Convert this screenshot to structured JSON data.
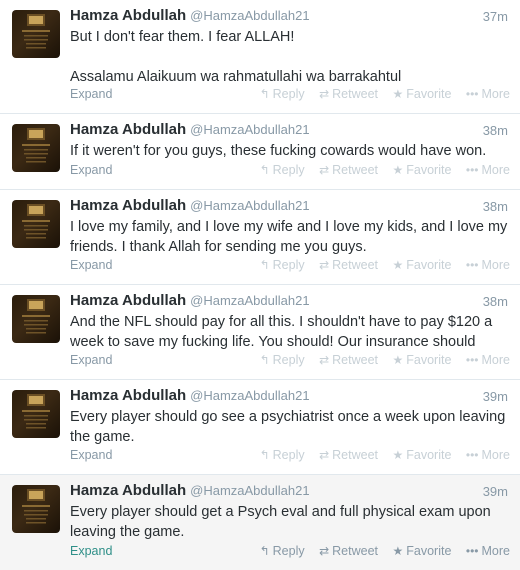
{
  "tweets": [
    {
      "fullname": "Hamza Abdullah",
      "username": "@HamzaAbdullah21",
      "time": "37m",
      "text": "But I don't fear them. I fear ALLAH!\n\nAssalamu Alaikuum wa rahmatullahi wa barrakahtul",
      "expand": "Expand"
    },
    {
      "fullname": "Hamza Abdullah",
      "username": "@HamzaAbdullah21",
      "time": "38m",
      "text": "If it weren't for you guys, these fucking cowards would have won.",
      "expand": "Expand"
    },
    {
      "fullname": "Hamza Abdullah",
      "username": "@HamzaAbdullah21",
      "time": "38m",
      "text": "I love my family, and I love my wife and I love my kids, and I love my friends. I thank Allah for sending me you guys.",
      "expand": "Expand"
    },
    {
      "fullname": "Hamza Abdullah",
      "username": "@HamzaAbdullah21",
      "time": "38m",
      "text": "And the NFL should pay for all this. I shouldn't have to pay $120 a week to save my fucking life. You should! Our insurance should",
      "expand": "Expand"
    },
    {
      "fullname": "Hamza Abdullah",
      "username": "@HamzaAbdullah21",
      "time": "39m",
      "text": "Every player should go see a psychiatrist once a week upon leaving the game.",
      "expand": "Expand"
    },
    {
      "fullname": "Hamza Abdullah",
      "username": "@HamzaAbdullah21",
      "time": "39m",
      "text": "Every player should get a Psych eval and full physical exam upon leaving the game.",
      "expand": "Expand"
    }
  ],
  "actions": {
    "reply": "Reply",
    "retweet": "Retweet",
    "favorite": "Favorite",
    "more": "More"
  },
  "icons": {
    "reply": "reply-arrow-icon",
    "retweet": "retweet-icon",
    "favorite": "star-icon",
    "more": "ellipsis-icon"
  },
  "colors": {
    "expand_active": "#2f8f88",
    "muted": "#8899a6",
    "divider": "#e1e8ed"
  }
}
